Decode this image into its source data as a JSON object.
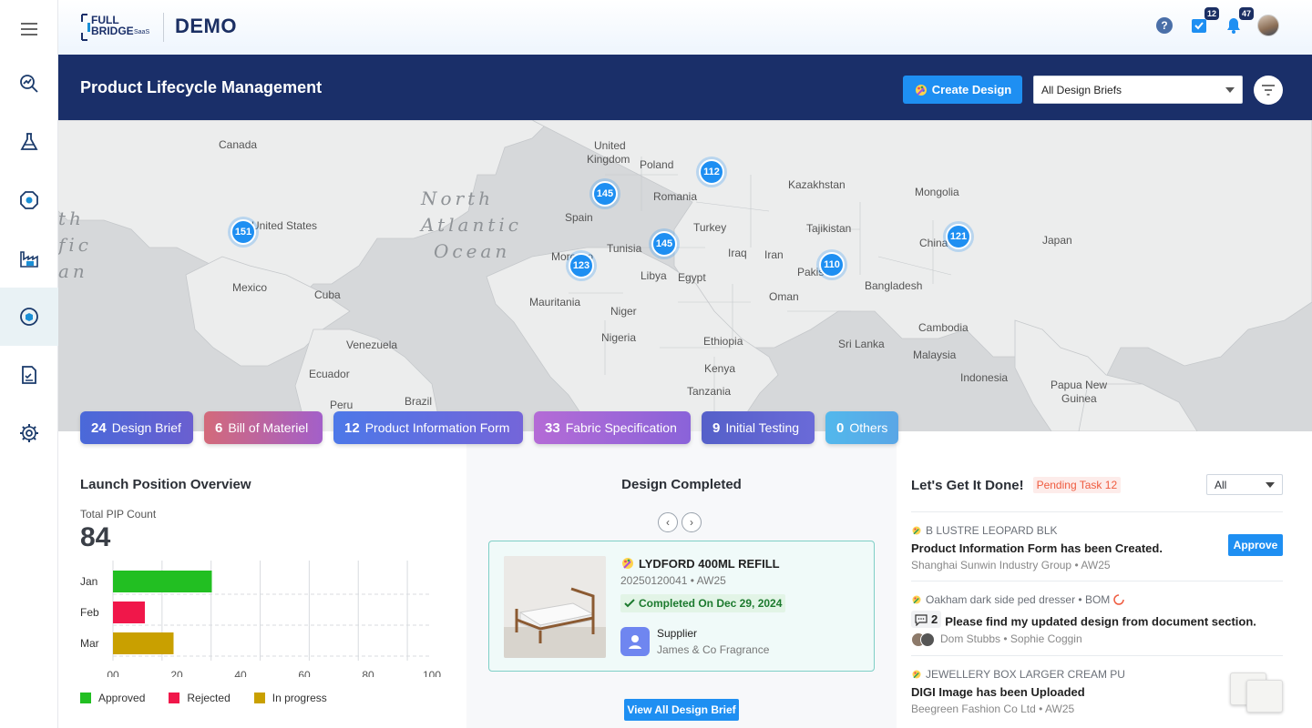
{
  "app": {
    "logo_text_1": "FULL",
    "logo_text_2": "BRIDGE",
    "logo_text_3": "SaaS",
    "brand": "DEMO"
  },
  "topbar": {
    "help_icon": "help-icon",
    "tasks_badge": "12",
    "notifications_badge": "47"
  },
  "sidebar": {
    "items": [
      {
        "name": "menu-icon"
      },
      {
        "name": "analytics-icon"
      },
      {
        "name": "lab-flask-icon"
      },
      {
        "name": "target-icon"
      },
      {
        "name": "factory-icon"
      },
      {
        "name": "product-lifecycle-icon",
        "active": true
      },
      {
        "name": "checklist-document-icon"
      },
      {
        "name": "settings-gear-icon"
      }
    ]
  },
  "header": {
    "title": "Product Lifecycle Management",
    "create_label": "Create Design",
    "brief_filter": "All Design Briefs"
  },
  "map": {
    "labels": [
      "Canada",
      "United",
      "Kingdom",
      "Poland",
      "Kazakhstan",
      "Mongolia",
      "Spain",
      "Romania",
      "Turkey",
      "Tajikistan",
      "United States",
      "Tunisia",
      "Iraq",
      "Iran",
      "China",
      "Japan",
      "Morocco",
      "Libya",
      "Egypt",
      "Pakistan",
      "Mexico",
      "Cuba",
      "Mauritania",
      "Oman",
      "Bangladesh",
      "Niger",
      "Cambodia",
      "Nigeria",
      "Ethiopia",
      "Sri Lanka",
      "Malaysia",
      "Venezuela",
      "Ecuador",
      "Kenya",
      "Indonesia",
      "Tanzania",
      "Papua New",
      "Guinea",
      "Peru",
      "Brazil"
    ],
    "ocean": [
      "North",
      "Atlantic",
      "Ocean"
    ],
    "ocean_west": [
      "th",
      "fic",
      "an"
    ],
    "clusters": [
      "112",
      "145",
      "151",
      "145",
      "121",
      "123",
      "110"
    ]
  },
  "chips": [
    {
      "count": "24",
      "label": "Design Brief",
      "color": "#4a69d9"
    },
    {
      "count": "6",
      "label": "Bill of Materiel",
      "color": "#c55b8c"
    },
    {
      "count": "12",
      "label": "Product Information Form",
      "color": "#5b6ee6"
    },
    {
      "count": "33",
      "label": "Fabric Specification",
      "color": "#9b63d6"
    },
    {
      "count": "9",
      "label": "Initial Testing",
      "color": "#5560c9"
    },
    {
      "count": "0",
      "label": "Others",
      "color": "#4fb6e8"
    }
  ],
  "launch": {
    "title": "Launch Position Overview",
    "pip_label": "Total PIP Count",
    "pip_count": "84",
    "legend": [
      "Approved",
      "Rejected",
      "In progress"
    ]
  },
  "chart_data": {
    "type": "bar",
    "orientation": "horizontal",
    "categories": [
      "Jan",
      "Feb",
      "Mar"
    ],
    "values": [
      31,
      10,
      19
    ],
    "colors": [
      "#22bf22",
      "#f0174a",
      "#c9a000"
    ],
    "xlim": [
      0,
      100
    ],
    "xticks": [
      "00",
      "20",
      "40",
      "60",
      "80",
      "100"
    ],
    "grid": true,
    "legend": [
      {
        "name": "Approved",
        "color": "#22bf22"
      },
      {
        "name": "Rejected",
        "color": "#f0174a"
      },
      {
        "name": "In progress",
        "color": "#c9a000"
      }
    ]
  },
  "design_completed": {
    "title": "Design Completed",
    "name": "LYDFORD 400ML REFILL",
    "code": "20250120041 • AW25",
    "status": "Completed On Dec 29, 2024",
    "supplier_label": "Supplier",
    "supplier": "James & Co Fragrance",
    "view_all": "View All Design Brief"
  },
  "tasks": {
    "title": "Let's Get It Done!",
    "pending_label": "Pending Task",
    "pending_count": "12",
    "filter": "All",
    "items": [
      {
        "sub": "B LUSTRE LEOPARD BLK",
        "main": "Product Information Form has been Created.",
        "meta": "Shanghai Sunwin Industry Group • AW25",
        "action": "Approve"
      },
      {
        "sub": "Oakham dark side ped dresser • BOM",
        "comments": "2",
        "main": "Please find my updated design from document section.",
        "meta": "Dom Stubbs • Sophie Coggin"
      },
      {
        "sub": "JEWELLERY BOX LARGER CREAM PU",
        "main": "DIGI Image has been Uploaded",
        "meta": "Beegreen Fashion Co Ltd • AW25"
      }
    ]
  }
}
